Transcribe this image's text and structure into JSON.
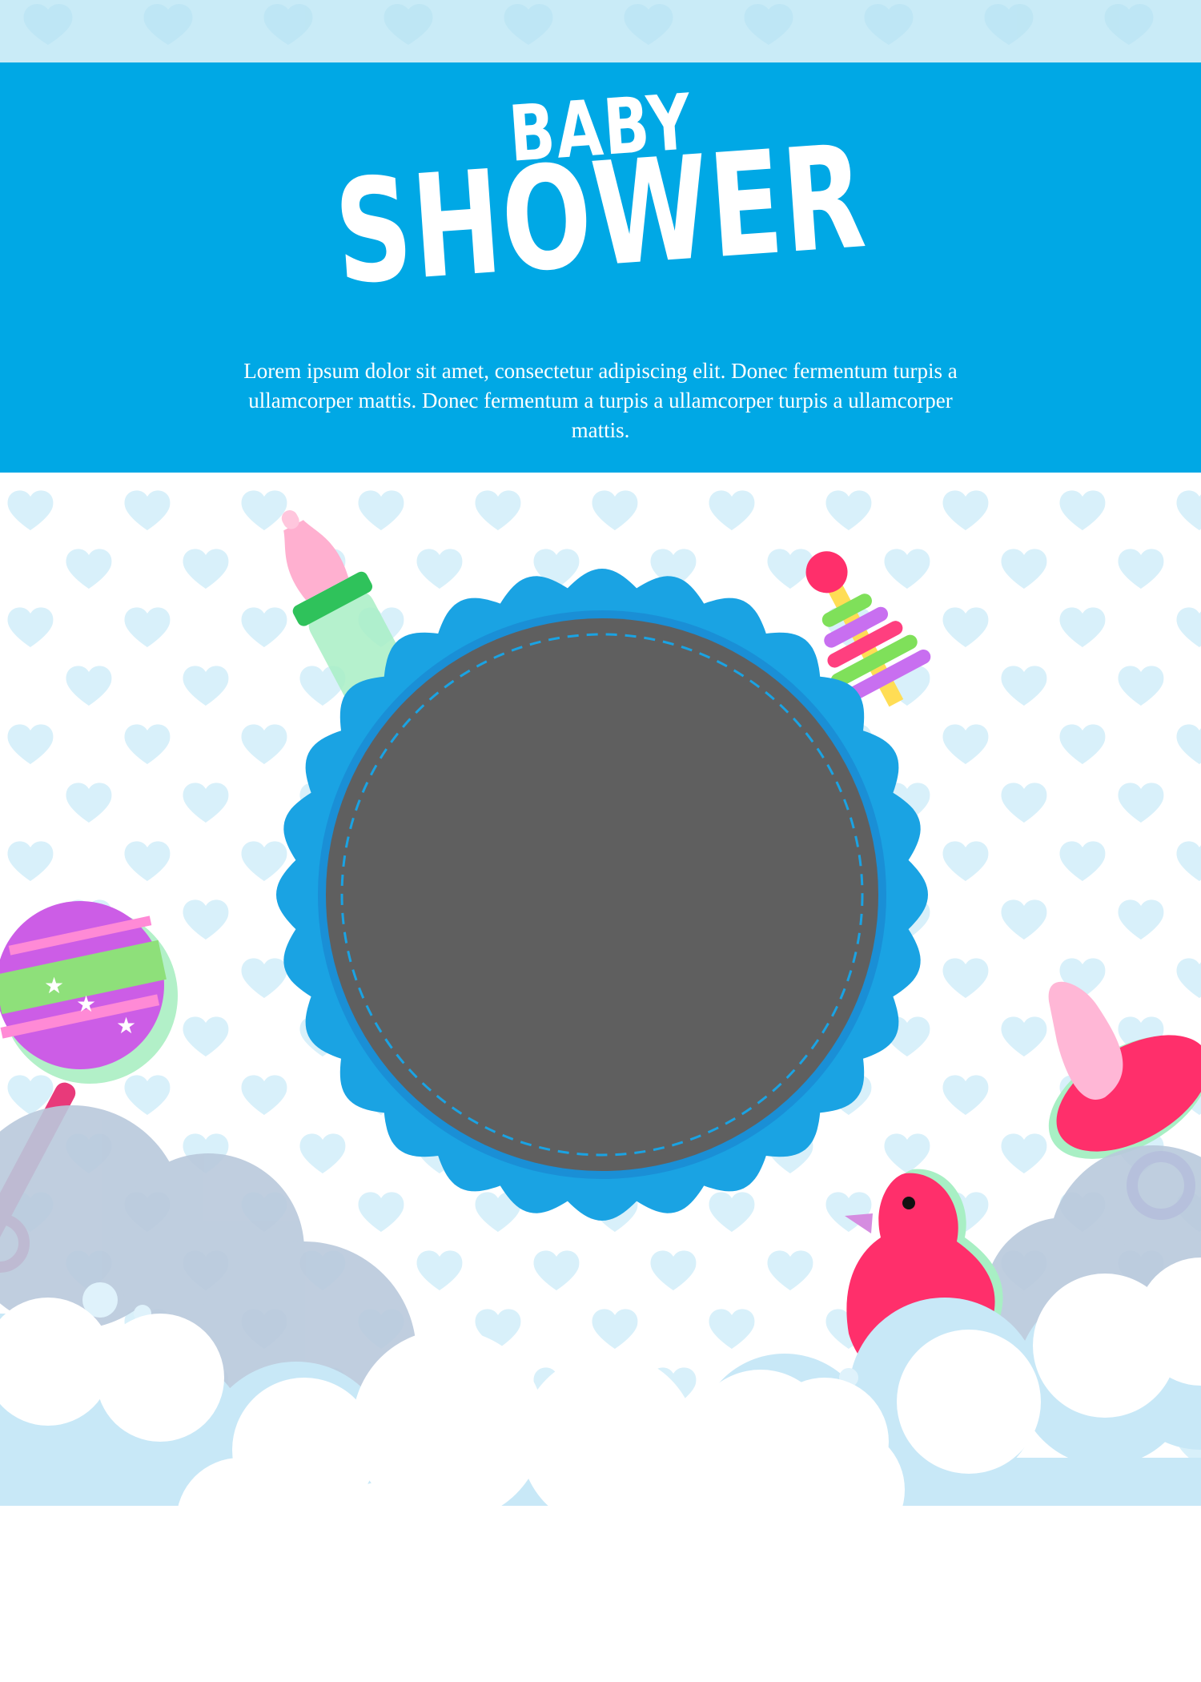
{
  "header": {
    "title_line1": "BABY",
    "title_line2": "SHOWER",
    "description": "Lorem ipsum dolor sit amet, consectetur adipiscing elit. Donec fermentum turpis a ullamcorper mattis. Donec fermentum a turpis a ullamcorper turpis a ullamcorper mattis."
  },
  "colors": {
    "banner": "#00a8e5",
    "top_strip": "#c9ebf7",
    "pattern_heart": "#d6f0fa",
    "frame_outer": "#1aa3e3",
    "frame_inner": "#1a8fd6",
    "photo_placeholder": "#5f5f5f",
    "cloud_back": "#b9c9dc",
    "cloud_mid": "#c8e8f7",
    "cloud_front": "#ffffff"
  },
  "icons": {
    "bottle": "baby-bottle-icon",
    "stacker": "ring-stacker-toy-icon",
    "rattle": "rattle-icon",
    "pacifier": "pacifier-icon",
    "duck": "rubber-duck-icon"
  }
}
